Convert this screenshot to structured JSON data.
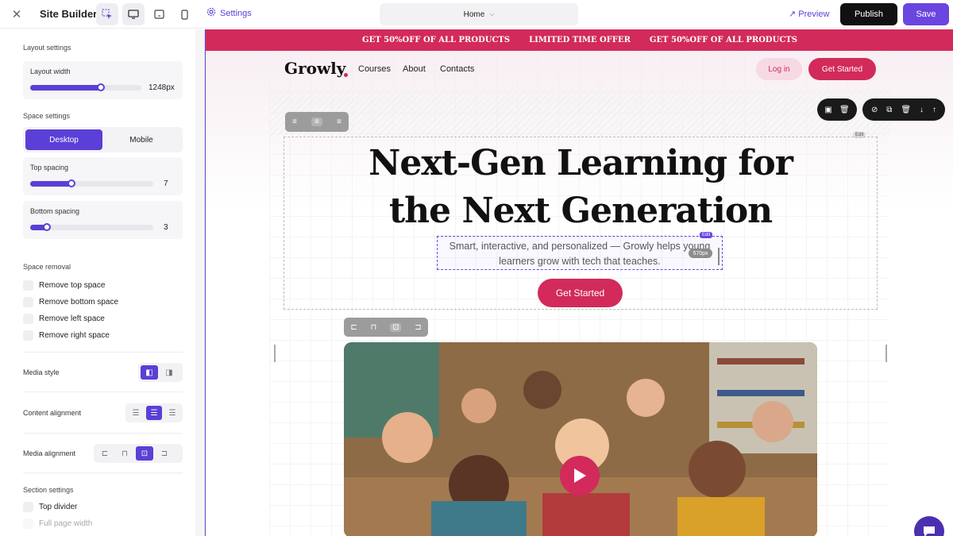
{
  "topbar": {
    "app_title": "Site Builder",
    "settings_label": "Settings",
    "page_selector": "Home",
    "preview_label": "Preview",
    "publish_label": "Publish",
    "save_label": "Save"
  },
  "sidebar": {
    "layout_settings_title": "Layout settings",
    "layout_width_label": "Layout width",
    "layout_width_value": "1248px",
    "layout_width_fraction": 0.45,
    "space_settings_title": "Space settings",
    "desktop_label": "Desktop",
    "mobile_label": "Mobile",
    "top_spacing_label": "Top spacing",
    "top_spacing_value": "7",
    "bottom_spacing_label": "Bottom spacing",
    "bottom_spacing_value": "3",
    "space_removal_title": "Space removal",
    "removal_options": [
      "Remove top space",
      "Remove bottom space",
      "Remove left space",
      "Remove right space"
    ],
    "media_style_label": "Media style",
    "content_alignment_label": "Content alignment",
    "media_alignment_label": "Media alignment",
    "section_settings_title": "Section settings",
    "top_divider_label": "Top divider",
    "full_page_width_label": "Full page width"
  },
  "promo": [
    "GET 50%OFF OF ALL PRODUCTS",
    "LIMITED TIME OFFER",
    "GET 50%OFF OF ALL PRODUCTS"
  ],
  "site": {
    "logo": "Growly",
    "nav": [
      "Courses",
      "About",
      "Contacts"
    ],
    "login": "Log in",
    "get_started": "Get Started"
  },
  "hero": {
    "edit_tag": "Edit",
    "headline_line1": "Next-Gen Learning for",
    "headline_line2": "the Next Generation",
    "sub_line1": "Smart, interactive, and personalized — Growly helps young",
    "sub_line2": "learners grow with tech that teaches.",
    "sub_edit_tag": "Edit",
    "width_tag": "570px",
    "cta": "Get Started"
  }
}
